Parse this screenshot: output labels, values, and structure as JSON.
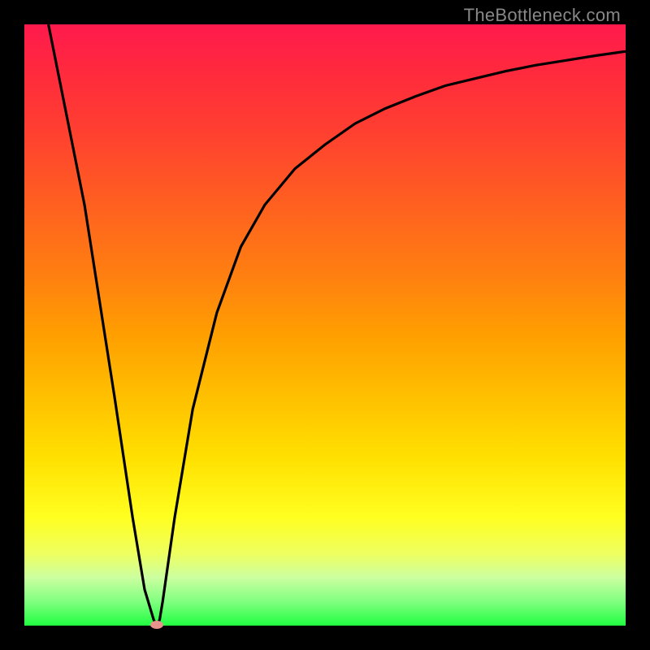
{
  "watermark": "TheBottleneck.com",
  "chart_data": {
    "type": "line",
    "title": "",
    "xlabel": "",
    "ylabel": "",
    "xlim": [
      0,
      100
    ],
    "ylim": [
      0,
      100
    ],
    "series": [
      {
        "name": "bottleneck-curve",
        "x": [
          4,
          10,
          15,
          18,
          20,
          21.5,
          22,
          22.5,
          23,
          25,
          28,
          32,
          36,
          40,
          45,
          50,
          55,
          60,
          65,
          70,
          75,
          80,
          85,
          90,
          95,
          100
        ],
        "y": [
          100,
          70,
          38,
          18,
          6,
          1,
          0,
          1,
          4,
          18,
          36,
          52,
          63,
          70,
          76,
          80,
          83.5,
          86,
          88,
          89.8,
          91,
          92.2,
          93.2,
          94,
          94.8,
          95.5
        ]
      }
    ],
    "annotations": [
      {
        "type": "marker",
        "x": 22,
        "y": 0,
        "label": "optimal-point"
      }
    ],
    "background_gradient": {
      "top": "#ff1a4d",
      "middle": "#ffe000",
      "bottom": "#20ff40"
    }
  }
}
